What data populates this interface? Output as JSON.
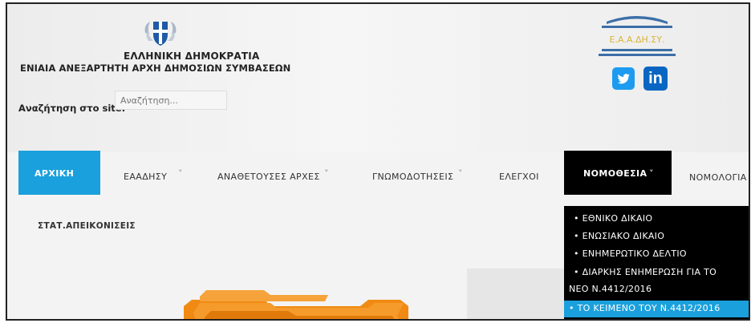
{
  "header": {
    "org_name": "ΕΛΛΗΝΙΚΗ ΔΗΜΟΚΡΑΤΙΑ",
    "org_subtitle": "ΕΝΙΑΙΑ ΑΝΕΞΑΡΤΗΤΗ ΑΡΧΗ ΔΗΜΟΣΙΩΝ ΣΥΜΒΑΣΕΩΝ",
    "search_label": "Αναζήτηση στο site:",
    "search_placeholder": "Αναζήτηση...",
    "logo_text": "Ε.Α.Α.ΔΗ.ΣΥ.",
    "social": {
      "twitter_icon": "twitter-icon",
      "linkedin_icon": "linkedin-icon",
      "linkedin_text": "in"
    }
  },
  "nav": {
    "items": [
      {
        "label": "ΑΡΧΙΚΗ",
        "active": true,
        "dropdown": false
      },
      {
        "label": "ΕΑΑΔΗΣΥ",
        "dropdown": true
      },
      {
        "label": "ΑΝΑΘΕΤΟΥΣΕΣ ΑΡΧΕΣ",
        "dropdown": true
      },
      {
        "label": "ΓΝΩΜΟΔΟΤΗΣΕΙΣ",
        "dropdown": true
      },
      {
        "label": "ΕΛΕΓΧΟΙ",
        "dropdown": false
      },
      {
        "label": "ΝΟΜΟΘΕΣΙΑ",
        "open": true,
        "dropdown": true
      },
      {
        "label": "ΝΟΜΟΛΟΓΙΑ",
        "dropdown": false
      }
    ],
    "row2": "ΣΤΑΤ.ΑΠΕΙΚΟΝΙΣΕΙΣ",
    "chevron": "˅"
  },
  "dropdown": {
    "items": [
      "• ΕΘΝΙΚΟ ΔΙΚΑΙΟ",
      "• ΕΝΩΣΙΑΚΟ ΔΙΚΑΙΟ",
      "• ΕΝΗΜΕΡΩΤΙΚΟ ΔΕΛΤΙΟ",
      "• ΔΙΑΡΚΗΣ ΕΝΗΜΕΡΩΣΗ ΓΙΑ ΤΟ",
      "ΝΕΟ Ν.4412/2016",
      "• ΤΟ ΚΕΙΜΕΝΟ ΤΟΥ Ν.4412/2016"
    ],
    "highlighted_index": 5
  },
  "colors": {
    "accent": "#1aa0dc",
    "nav_active_bg": "#000000",
    "twitter": "#1d9bf0",
    "linkedin": "#0a66c2",
    "logo_gold": "#d9b43a",
    "logo_blue": "#3b6fa8",
    "folder_orange": "#f08a12"
  }
}
